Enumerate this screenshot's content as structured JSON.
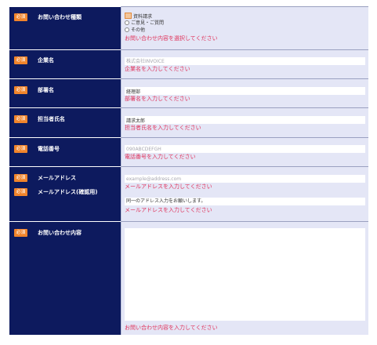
{
  "required_badge": "必須",
  "inquiry_type": {
    "label": "お問い合わせ種類",
    "options": [
      "資料請求",
      "ご意見・ご質問",
      "その他"
    ],
    "error": "お問い合わせ内容を選択してください"
  },
  "company": {
    "label": "企業名",
    "placeholder": "株式会社INVOICE",
    "error": "企業名を入力してください"
  },
  "department": {
    "label": "部署名",
    "value": "経理部",
    "error": "部署名を入力してください"
  },
  "contact_name": {
    "label": "担当者氏名",
    "value": "請求太郎",
    "error": "担当者氏名を入力してください"
  },
  "phone": {
    "label": "電話番号",
    "placeholder": "090ABCDEFGH",
    "error": "電話番号を入力してください"
  },
  "email": {
    "label": "メールアドレス",
    "placeholder": "example@address.com",
    "error": "メールアドレスを入力してください"
  },
  "email_confirm": {
    "label": "メールアドレス(確認用)",
    "note": "同一のアドレス入力をお願いします。",
    "error": "メールアドレスを入力してください"
  },
  "message": {
    "label": "お問い合わせ内容",
    "error": "お問い合わせ内容を入力してください"
  },
  "colors": {
    "label_bg": "#0d1a5e",
    "value_bg": "#e4e6f6",
    "badge": "#f1842b",
    "error": "#e0325a"
  }
}
